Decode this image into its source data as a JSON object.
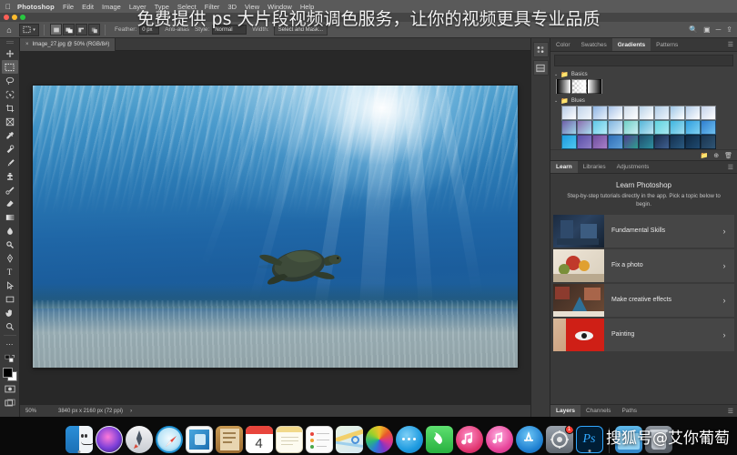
{
  "macos_menu": {
    "apple": "",
    "app_name": "Photoshop",
    "items": [
      "File",
      "Edit",
      "Image",
      "Layer",
      "Type",
      "Select",
      "Filter",
      "3D",
      "View",
      "Window",
      "Help"
    ]
  },
  "options_bar": {
    "home_icon": "home-icon",
    "tool_icon": "rectangular-marquee-icon",
    "tool_preset_caret": "▾",
    "selection_modes": [
      "new-selection",
      "add-to-selection",
      "subtract-from-selection",
      "intersect-with-selection"
    ],
    "feather_label": "Feather:",
    "feather_value": "0 px",
    "antialias_label": "Anti-alias",
    "style_label": "Style:",
    "style_value": "Normal",
    "width_label": "Width:",
    "select_and_mask": "Select and Mask...",
    "right_icons": [
      "search-icon",
      "arrange-documents-icon",
      "workspace-switcher-icon",
      "share-icon"
    ]
  },
  "toolbar": {
    "tools": [
      {
        "name": "move-tool",
        "selected": false
      },
      {
        "name": "rectangular-marquee-tool",
        "selected": true
      },
      {
        "name": "lasso-tool",
        "selected": false
      },
      {
        "name": "object-selection-tool",
        "selected": false
      },
      {
        "name": "crop-tool",
        "selected": false
      },
      {
        "name": "frame-tool",
        "selected": false
      },
      {
        "name": "eyedropper-tool",
        "selected": false
      },
      {
        "name": "spot-healing-brush-tool",
        "selected": false
      },
      {
        "name": "brush-tool",
        "selected": false
      },
      {
        "name": "clone-stamp-tool",
        "selected": false
      },
      {
        "name": "history-brush-tool",
        "selected": false
      },
      {
        "name": "eraser-tool",
        "selected": false
      },
      {
        "name": "gradient-tool",
        "selected": false
      },
      {
        "name": "blur-tool",
        "selected": false
      },
      {
        "name": "dodge-tool",
        "selected": false
      },
      {
        "name": "pen-tool",
        "selected": false
      },
      {
        "name": "type-tool",
        "selected": false
      },
      {
        "name": "path-selection-tool",
        "selected": false
      },
      {
        "name": "rectangle-tool",
        "selected": false
      },
      {
        "name": "hand-tool",
        "selected": false
      },
      {
        "name": "zoom-tool",
        "selected": false
      },
      {
        "name": "edit-toolbar-tool",
        "selected": false
      }
    ],
    "foreground_color": "#000000",
    "background_color": "#ffffff",
    "quick_mask_icon": "quick-mask-icon",
    "screen_mode_icon": "screen-mode-icon"
  },
  "document": {
    "tab_label": "Image_27.jpg @ 50% (RGB/8#)",
    "close_glyph": "×",
    "status_zoom": "50%",
    "status_dimensions": "3840 px x 2160 px (72 ppi)",
    "status_arrow": "›"
  },
  "right_rail": {
    "buttons": [
      "color-properties-icon",
      "adjustments-icon"
    ]
  },
  "gradients_panel": {
    "tabs": [
      "Color",
      "Swatches",
      "Gradients",
      "Patterns"
    ],
    "active_tab": "Gradients",
    "menu_icon": "panel-menu-icon",
    "groups": [
      {
        "name": "Basics",
        "expanded": true,
        "chevron": "⌄",
        "folder_icon": "folder-icon",
        "swatches": [
          [
            "#000000",
            "#ffffff"
          ],
          [
            "checker",
            "#ffffff"
          ],
          [
            "#ffffff",
            "#000000"
          ]
        ]
      },
      {
        "name": "Blues",
        "expanded": true,
        "chevron": "⌄",
        "folder_icon": "folder-icon",
        "rows": [
          [
            "#b7cbe6,#ffffff",
            "#c2d4ea,#f2f7fc",
            "#8fb6e4,#e9f1fa",
            "#a8c4e8,#ffffff",
            "#cfdcea,#ffffff",
            "#b8d2e8,#ffffff",
            "#b0cde6,#eef4fb",
            "#9ec6e6,#ffffff",
            "#b3cde8,#ffffff",
            "#c4d2ea,#ffffff"
          ],
          [
            "#6f5fa8,#9fd6e8",
            "#8b6fb0,#a9dff0",
            "#5fc8e8,#b6ecf7",
            "#7fb4e0,#d8ecf7",
            "#6fd0c8,#cdeef2",
            "#55b6d8,#bfe6f2",
            "#5fd4e0,#a8e6ef",
            "#3fb6e0,#9fdcef",
            "#2f9fe0,#7fd0f0",
            "#2f7fd0,#6fc0ee"
          ],
          [
            "#1e9be0,#4fc8ef",
            "#5a4fa8,#8f7fc8",
            "#6f4f9f,#a87fc8",
            "#2f6fb8,#5f9fd8",
            "#4f3f8f,#2f9f8f",
            "#1f4f6f,#2f8f9f",
            "#1a2f4f,#3f5f8f",
            "#143050,#2a5a80",
            "#0f2a45,#1f4a70",
            "#1a3550,#2f5575"
          ]
        ]
      }
    ],
    "footer_icons": [
      "new-group-icon",
      "new-gradient-icon",
      "delete-icon"
    ]
  },
  "learn_panel": {
    "tabs": [
      "Learn",
      "Libraries",
      "Adjustments"
    ],
    "active_tab": "Learn",
    "menu_icon": "panel-menu-icon",
    "title": "Learn Photoshop",
    "subtitle": "Step-by-step tutorials directly in the app. Pick a topic below to begin.",
    "cards": [
      {
        "label": "Fundamental Skills",
        "chevron": "›",
        "thumb": "dark-room-photo"
      },
      {
        "label": "Fix a photo",
        "chevron": "›",
        "thumb": "flowers-photo"
      },
      {
        "label": "Make creative effects",
        "chevron": "›",
        "thumb": "collage-photo"
      },
      {
        "label": "Painting",
        "chevron": "›",
        "thumb": "red-fish-painting"
      }
    ]
  },
  "layers_panel": {
    "tabs": [
      "Layers",
      "Channels",
      "Paths"
    ],
    "active_tab": "Layers",
    "menu_icon": "panel-menu-icon"
  },
  "dock": {
    "items": [
      {
        "name": "finder-icon",
        "label": "Finder",
        "running": true
      },
      {
        "name": "siri-icon",
        "label": "Siri",
        "running": false
      },
      {
        "name": "launchpad-icon",
        "label": "Launchpad",
        "running": false
      },
      {
        "name": "safari-icon",
        "label": "Safari",
        "running": false
      },
      {
        "name": "mail-icon",
        "label": "Mail",
        "running": false
      },
      {
        "name": "contacts-icon",
        "label": "Contacts",
        "running": false
      },
      {
        "name": "calendar-icon",
        "label": "Calendar",
        "running": false,
        "day": "4"
      },
      {
        "name": "notes-icon",
        "label": "Notes",
        "running": false
      },
      {
        "name": "reminders-icon",
        "label": "Reminders",
        "running": false
      },
      {
        "name": "maps-icon",
        "label": "Maps",
        "running": false
      },
      {
        "name": "photos-icon",
        "label": "Photos",
        "running": false
      },
      {
        "name": "messages-icon",
        "label": "Messages",
        "running": false
      },
      {
        "name": "facetime-icon",
        "label": "FaceTime",
        "running": false
      },
      {
        "name": "itunes-icon",
        "label": "iTunes",
        "running": false
      },
      {
        "name": "music-icon",
        "label": "Music",
        "running": false
      },
      {
        "name": "app-store-icon",
        "label": "App Store",
        "running": false
      },
      {
        "name": "system-preferences-icon",
        "label": "System Preferences",
        "running": false,
        "badge": "1"
      },
      {
        "name": "photoshop-icon",
        "label": "Ps",
        "running": true
      }
    ],
    "trash_name": "trash-icon",
    "downloads_name": "downloads-folder-icon"
  },
  "overlay": {
    "headline": "免费提供 ps 大片段视频调色服务，让你的视频更具专业品质",
    "watermark": "搜狐号@艾你葡萄"
  },
  "colors": {
    "panel_bg": "#3a3a3a",
    "panel_alt": "#3f3f3f",
    "canvas_bg": "#282828",
    "accent": "#4b4b4b"
  }
}
